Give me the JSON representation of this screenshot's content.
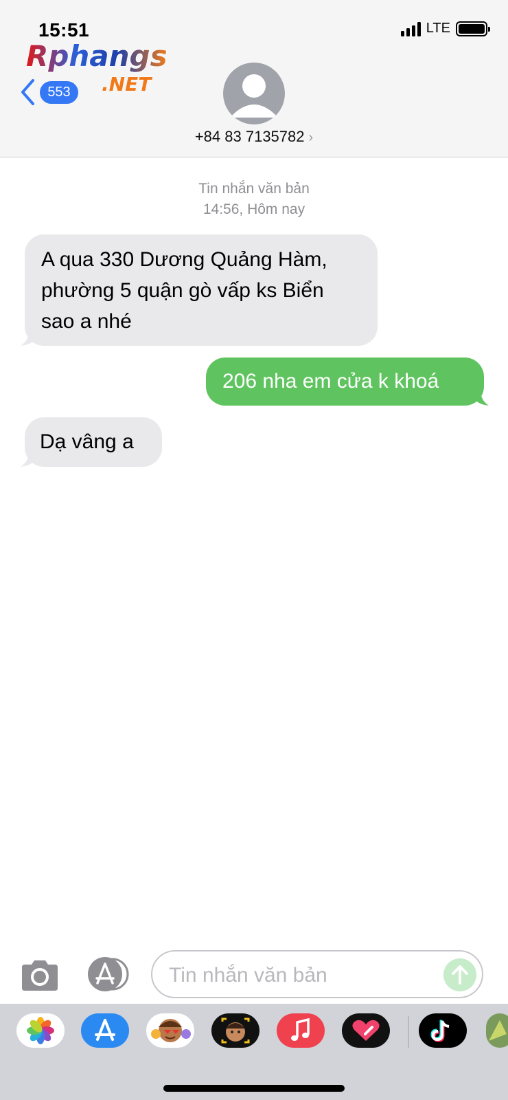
{
  "status_bar": {
    "time": "15:51",
    "network": "LTE"
  },
  "watermark": {
    "line1": "Rphangs",
    "line2": ".NET"
  },
  "header": {
    "back_count": "553",
    "contact": "+84 83 7135782"
  },
  "conversation": {
    "meta_type": "Tin nhắn văn bản",
    "meta_time": "14:56, Hôm nay",
    "messages": [
      {
        "direction": "received",
        "text": "A qua 330 Dương Quảng Hàm, phường 5 quận gò vấp ks Biển sao a nhé"
      },
      {
        "direction": "sent",
        "text": "206 nha em cửa k khoá"
      },
      {
        "direction": "received",
        "text": "Dạ vâng a"
      }
    ]
  },
  "composer": {
    "placeholder": "Tin nhắn văn bản"
  },
  "app_drawer": {
    "apps": [
      "photos-icon",
      "app-store-icon",
      "memoji-stickers-icon",
      "memoji-icon",
      "music-icon",
      "digital-touch-icon",
      "tiktok-icon",
      "more-app-icon"
    ]
  },
  "colors": {
    "sent_bubble": "#5fc45f",
    "received_bubble": "#e9e9eb",
    "accent": "#3478f6"
  }
}
